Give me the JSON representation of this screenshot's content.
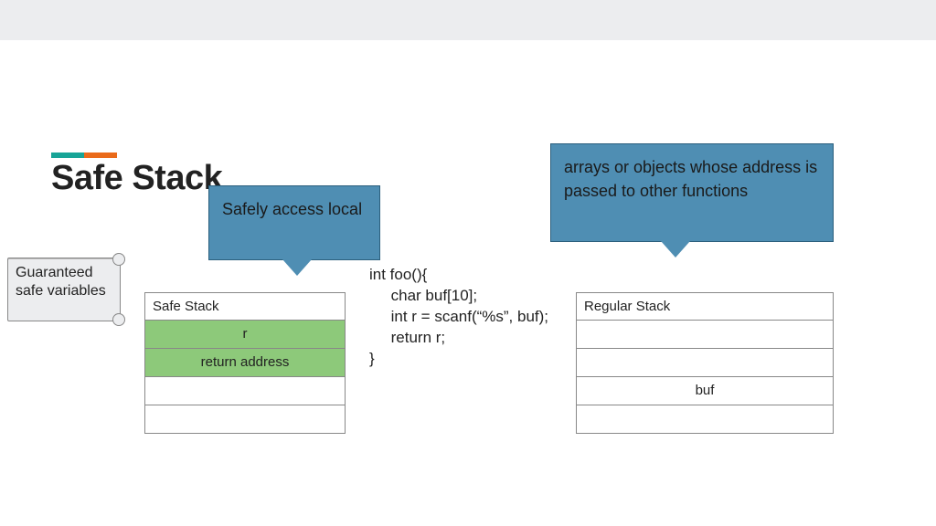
{
  "title": "Safe Stack",
  "scroll_note": "Guaranteed safe variables",
  "callout_local": "Safely access local",
  "callout_arrays": "arrays or objects whose address is passed to other functions",
  "safe_stack": {
    "header": "Safe Stack",
    "row_r": "r",
    "row_ret": "return address",
    "row_e1": "",
    "row_e2": ""
  },
  "regular_stack": {
    "header": "Regular Stack",
    "row_e1": "",
    "row_e2": "",
    "row_buf": "buf",
    "row_e3": ""
  },
  "code": "int foo(){\n     char buf[10];\n     int r = scanf(“%s”, buf);\n     return r;\n}"
}
